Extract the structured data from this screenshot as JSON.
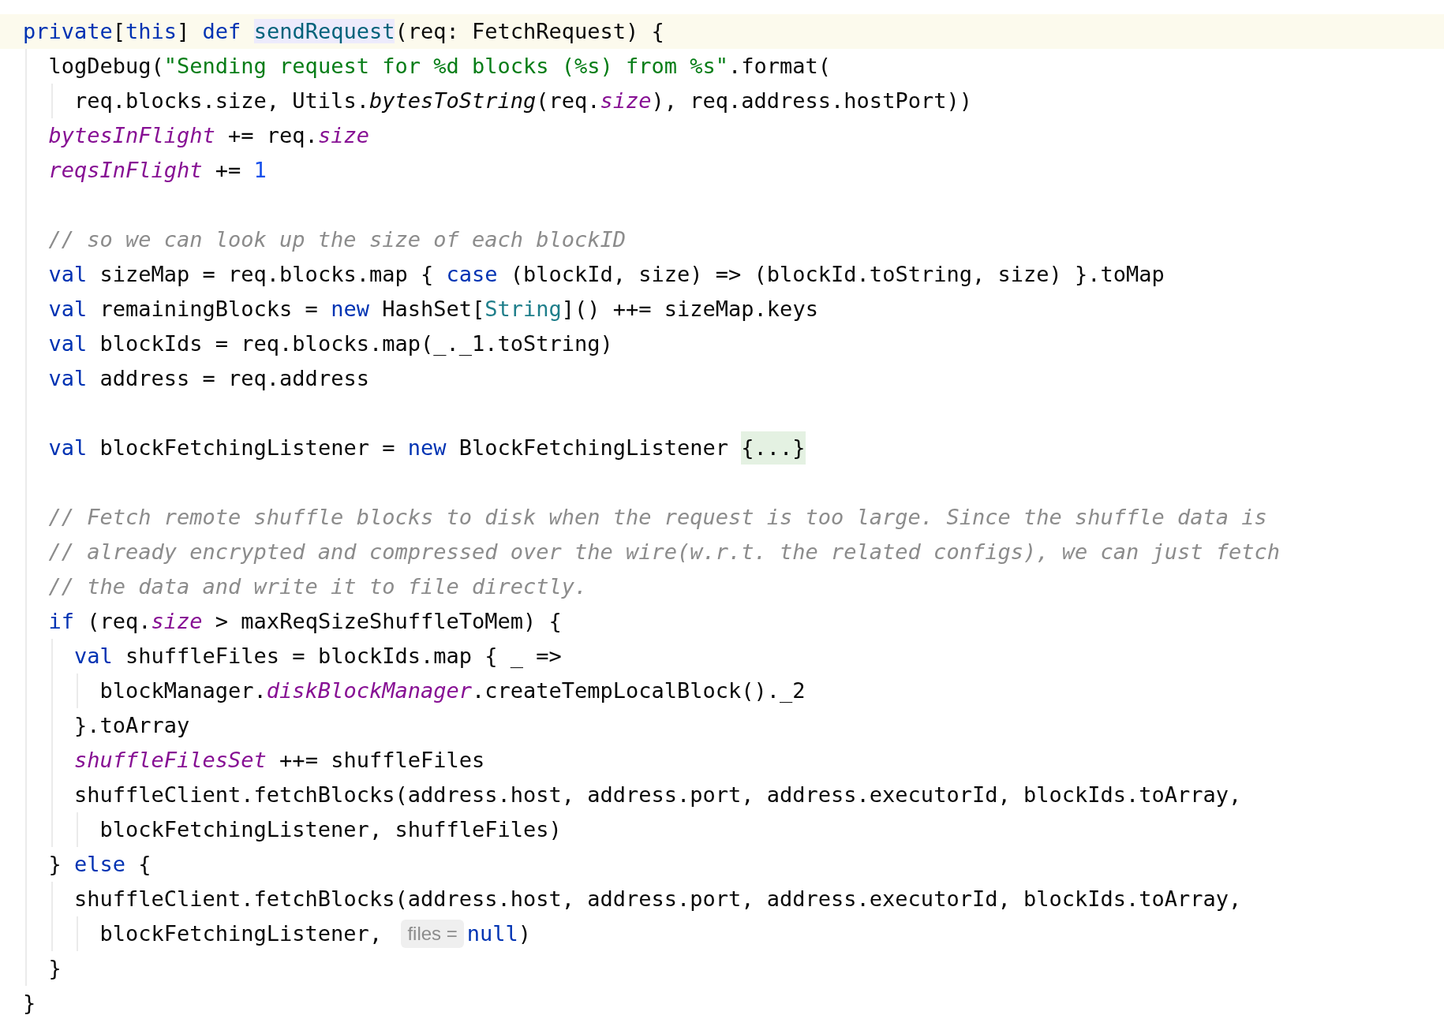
{
  "lines": [
    {
      "current": true,
      "tokens": [
        {
          "kind": "keyword",
          "text": "private"
        },
        {
          "kind": "plain",
          "text": "["
        },
        {
          "kind": "keyword",
          "text": "this"
        },
        {
          "kind": "plain",
          "text": "] "
        },
        {
          "kind": "keyword",
          "text": "def "
        },
        {
          "kind": "declaration",
          "text": "sendRequest"
        },
        {
          "kind": "plain",
          "text": "(req: FetchRequest) {"
        }
      ],
      "children": [
        {
          "current": false,
          "tokens": [
            {
              "kind": "plain",
              "text": "logDebug("
            },
            {
              "kind": "string",
              "text": "\"Sending request for %d blocks (%s) from %s\""
            },
            {
              "kind": "plain",
              "text": ".format("
            }
          ],
          "children": [
            {
              "current": false,
              "tokens": [
                {
                  "kind": "plain",
                  "text": "req.blocks.size, Utils."
                },
                {
                  "kind": "static",
                  "text": "bytesToString"
                },
                {
                  "kind": "plain",
                  "text": "(req."
                },
                {
                  "kind": "field",
                  "text": "size"
                },
                {
                  "kind": "plain",
                  "text": "), req.address.hostPort))"
                }
              ]
            }
          ]
        },
        {
          "current": false,
          "tokens": [
            {
              "kind": "field",
              "text": "bytesInFlight"
            },
            {
              "kind": "plain",
              "text": " += req."
            },
            {
              "kind": "field",
              "text": "size"
            }
          ]
        },
        {
          "current": false,
          "tokens": [
            {
              "kind": "field",
              "text": "reqsInFlight"
            },
            {
              "kind": "plain",
              "text": " += "
            },
            {
              "kind": "number",
              "text": "1"
            }
          ]
        },
        {
          "current": false
        },
        {
          "current": false,
          "tokens": [
            {
              "kind": "comment",
              "text": "// so we can look up the size of each blockID"
            }
          ]
        },
        {
          "current": false,
          "tokens": [
            {
              "kind": "keyword",
              "text": "val"
            },
            {
              "kind": "plain",
              "text": " sizeMap = req.blocks.map { "
            },
            {
              "kind": "keyword",
              "text": "case"
            },
            {
              "kind": "plain",
              "text": " (blockId, size) => (blockId.toString, size) }.toMap"
            }
          ]
        },
        {
          "current": false,
          "tokens": [
            {
              "kind": "keyword",
              "text": "val"
            },
            {
              "kind": "plain",
              "text": " remainingBlocks = "
            },
            {
              "kind": "keyword",
              "text": "new"
            },
            {
              "kind": "plain",
              "text": " HashSet["
            },
            {
              "kind": "type",
              "text": "String"
            },
            {
              "kind": "plain",
              "text": "]() ++= sizeMap.keys"
            }
          ]
        },
        {
          "current": false,
          "tokens": [
            {
              "kind": "keyword",
              "text": "val"
            },
            {
              "kind": "plain",
              "text": " blockIds = req.blocks.map(_._1.toString)"
            }
          ]
        },
        {
          "current": false,
          "tokens": [
            {
              "kind": "keyword",
              "text": "val"
            },
            {
              "kind": "plain",
              "text": " address = req.address"
            }
          ]
        },
        {
          "current": false
        },
        {
          "current": false,
          "tokens": [
            {
              "kind": "keyword",
              "text": "val"
            },
            {
              "kind": "plain",
              "text": " blockFetchingListener = "
            },
            {
              "kind": "keyword",
              "text": "new"
            },
            {
              "kind": "plain",
              "text": " BlockFetchingListener "
            },
            {
              "kind": "fold",
              "text": "{...}"
            }
          ]
        },
        {
          "current": false
        },
        {
          "current": false,
          "tokens": [
            {
              "kind": "comment",
              "text": "// Fetch remote shuffle blocks to disk when the request is too large. Since the shuffle data is"
            }
          ]
        },
        {
          "current": false,
          "tokens": [
            {
              "kind": "comment",
              "text": "// already encrypted and compressed over the wire(w.r.t. the related configs), we can just fetch"
            }
          ]
        },
        {
          "current": false,
          "tokens": [
            {
              "kind": "comment",
              "text": "// the data and write it to file directly."
            }
          ]
        },
        {
          "current": false,
          "tokens": [
            {
              "kind": "keyword",
              "text": "if"
            },
            {
              "kind": "plain",
              "text": " (req."
            },
            {
              "kind": "field",
              "text": "size"
            },
            {
              "kind": "plain",
              "text": " > maxReqSizeShuffleToMem) {"
            }
          ],
          "children": [
            {
              "current": false,
              "tokens": [
                {
                  "kind": "keyword",
                  "text": "val"
                },
                {
                  "kind": "plain",
                  "text": " shuffleFiles = blockIds.map { _ =>"
                }
              ],
              "children": [
                {
                  "current": false,
                  "tokens": [
                    {
                      "kind": "plain",
                      "text": "blockManager."
                    },
                    {
                      "kind": "field",
                      "text": "diskBlockManager"
                    },
                    {
                      "kind": "plain",
                      "text": ".createTempLocalBlock()._2"
                    }
                  ]
                }
              ]
            },
            {
              "current": false,
              "tokens": [
                {
                  "kind": "plain",
                  "text": "}.toArray"
                }
              ]
            },
            {
              "current": false,
              "tokens": [
                {
                  "kind": "field",
                  "text": "shuffleFilesSet"
                },
                {
                  "kind": "plain",
                  "text": " ++= shuffleFiles"
                }
              ]
            },
            {
              "current": false,
              "tokens": [
                {
                  "kind": "plain",
                  "text": "shuffleClient.fetchBlocks(address.host, address.port, address.executorId, blockIds.toArray,"
                }
              ],
              "children": [
                {
                  "current": false,
                  "tokens": [
                    {
                      "kind": "plain",
                      "text": "blockFetchingListener, shuffleFiles)"
                    }
                  ]
                }
              ]
            }
          ]
        },
        {
          "current": false,
          "tokens": [
            {
              "kind": "plain",
              "text": "} "
            },
            {
              "kind": "keyword",
              "text": "else"
            },
            {
              "kind": "plain",
              "text": " {"
            }
          ],
          "children": [
            {
              "current": false,
              "tokens": [
                {
                  "kind": "plain",
                  "text": "shuffleClient.fetchBlocks(address.host, address.port, address.executorId, blockIds.toArray,"
                }
              ],
              "children": [
                {
                  "current": false,
                  "tokens": [
                    {
                      "kind": "plain",
                      "text": "blockFetchingListener, "
                    },
                    {
                      "kind": "hint",
                      "text": "files ="
                    },
                    {
                      "kind": "keyword",
                      "text": "null"
                    },
                    {
                      "kind": "plain",
                      "text": ")"
                    }
                  ]
                }
              ]
            }
          ]
        },
        {
          "current": false,
          "tokens": [
            {
              "kind": "plain",
              "text": "}"
            }
          ]
        }
      ]
    },
    {
      "current": false,
      "tokens": [
        {
          "kind": "plain",
          "text": "}"
        }
      ]
    }
  ]
}
